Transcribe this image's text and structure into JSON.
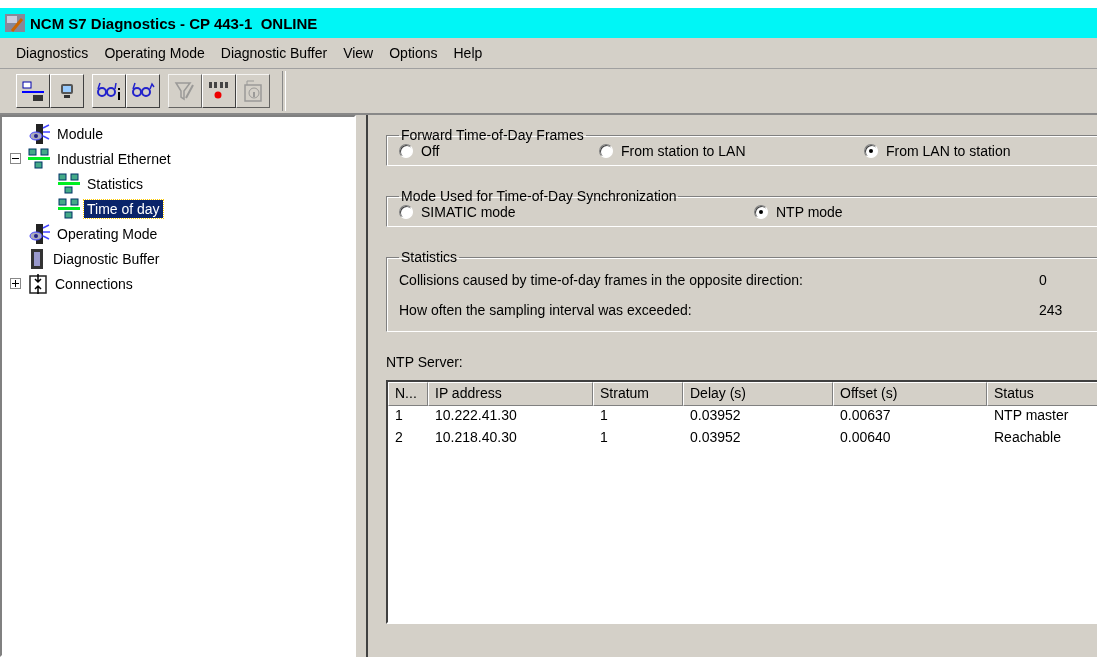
{
  "window": {
    "title": "NCM S7 Diagnostics - CP 443-1  ONLINE"
  },
  "menu": [
    "Diagnostics",
    "Operating Mode",
    "Diagnostic Buffer",
    "View",
    "Options",
    "Help"
  ],
  "toolbar": [
    [
      {
        "kind": "station",
        "disabled": false
      },
      {
        "kind": "monitor",
        "disabled": false
      }
    ],
    [
      {
        "kind": "glasses-info",
        "disabled": false
      },
      {
        "kind": "glasses",
        "disabled": false
      }
    ],
    [
      {
        "kind": "filter",
        "disabled": true
      },
      {
        "kind": "leds",
        "disabled": false
      },
      {
        "kind": "info",
        "disabled": true
      }
    ]
  ],
  "tree": [
    {
      "label": "Module",
      "kind": "module",
      "selected": false
    },
    {
      "label": "Industrial Ethernet",
      "kind": "network",
      "selected": false,
      "expanded": true,
      "children": [
        {
          "label": "Statistics",
          "kind": "network",
          "selected": false
        },
        {
          "label": "Time of day",
          "kind": "network",
          "selected": true
        }
      ]
    },
    {
      "label": "Operating Mode",
      "kind": "module",
      "selected": false
    },
    {
      "label": "Diagnostic Buffer",
      "kind": "buffer",
      "selected": false
    },
    {
      "label": "Connections",
      "kind": "connections",
      "selected": false,
      "expanded": false
    }
  ],
  "forward_group": {
    "title": "Forward Time-of-Day Frames",
    "options": [
      {
        "label": "Off",
        "selected": false
      },
      {
        "label": "From station to LAN",
        "selected": false
      },
      {
        "label": "From LAN to station",
        "selected": true
      }
    ]
  },
  "mode_group": {
    "title": "Mode Used for Time-of-Day Synchronization",
    "options": [
      {
        "label": "SIMATIC mode",
        "selected": false
      },
      {
        "label": "NTP mode",
        "selected": true
      }
    ]
  },
  "statistics": {
    "title": "Statistics",
    "rows": [
      {
        "label": "Collisions caused by time-of-day frames in the opposite direction:",
        "value": "0"
      },
      {
        "label": "How often the sampling interval was exceeded:",
        "value": "243"
      }
    ]
  },
  "ntp": {
    "label": "NTP Server:",
    "columns": [
      "N...",
      "IP address",
      "Stratum",
      "Delay (s)",
      "Offset (s)",
      "Status"
    ],
    "rows": [
      [
        "1",
        "10.222.41.30",
        "1",
        "0.03952",
        "0.00637",
        "NTP master"
      ],
      [
        "2",
        "10.218.40.30",
        "1",
        "0.03952",
        "0.00640",
        "Reachable"
      ]
    ]
  }
}
